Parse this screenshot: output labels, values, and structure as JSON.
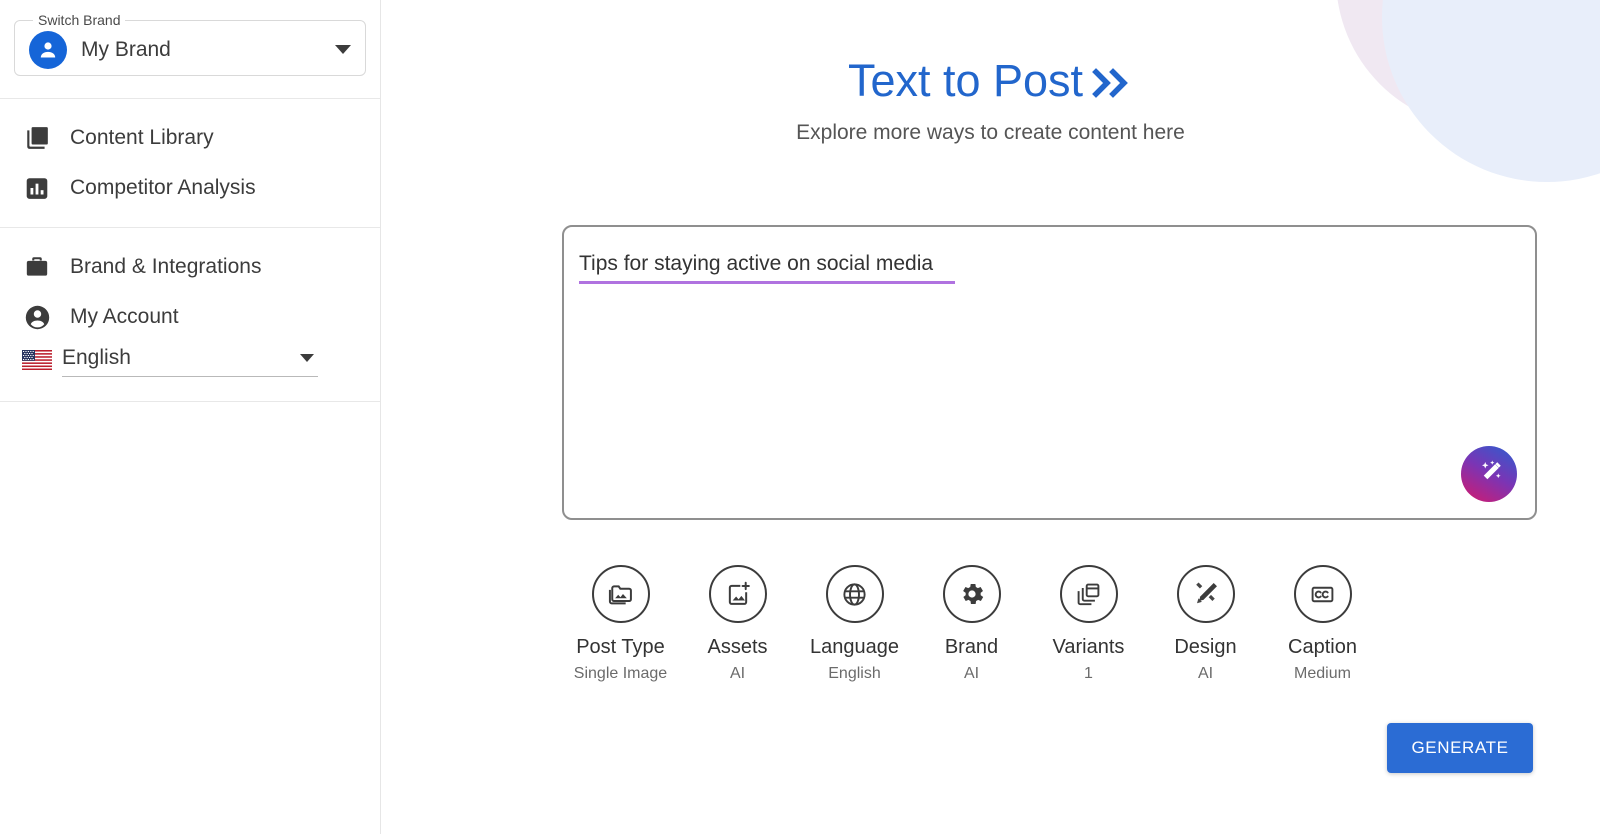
{
  "sidebar": {
    "brand_switch": {
      "legend": "Switch Brand",
      "value": "My Brand",
      "avatar_icon": "person-icon",
      "caret_icon": "chevron-down-icon"
    },
    "groups": [
      {
        "items": [
          {
            "label": "Content Library",
            "icon": "image-library-icon"
          },
          {
            "label": "Competitor Analysis",
            "icon": "bar-chart-icon"
          }
        ]
      },
      {
        "items": [
          {
            "label": "Brand & Integrations",
            "icon": "briefcase-icon"
          },
          {
            "label": "My Account",
            "icon": "account-circle-icon"
          }
        ]
      }
    ],
    "language": {
      "label": "English",
      "flag_icon": "us-flag-icon",
      "caret_icon": "chevron-down-icon"
    }
  },
  "header": {
    "title": "Text to Post",
    "title_icon": "double-chevron-right-icon",
    "subtitle": "Explore more ways to create content here",
    "title_color": "#2266cc"
  },
  "composer": {
    "value": "Tips for staying active on social media",
    "placeholder": "",
    "underline_color": "#b072e0",
    "magic_button": {
      "icon": "magic-wand-icon",
      "gradient_from": "#2b5fd0",
      "gradient_to": "#d6196b"
    }
  },
  "options": [
    {
      "label": "Post Type",
      "value": "Single Image",
      "icon": "folder-image-icon"
    },
    {
      "label": "Assets",
      "value": "AI",
      "icon": "add-image-icon"
    },
    {
      "label": "Language",
      "value": "English",
      "icon": "globe-icon"
    },
    {
      "label": "Brand",
      "value": "AI",
      "icon": "gear-icon"
    },
    {
      "label": "Variants",
      "value": "1",
      "icon": "copies-icon"
    },
    {
      "label": "Design",
      "value": "AI",
      "icon": "pencil-ruler-icon"
    },
    {
      "label": "Caption",
      "value": "Medium",
      "icon": "closed-caption-icon"
    }
  ],
  "actions": {
    "generate_label": "GENERATE",
    "generate_color": "#2b6cd4"
  }
}
